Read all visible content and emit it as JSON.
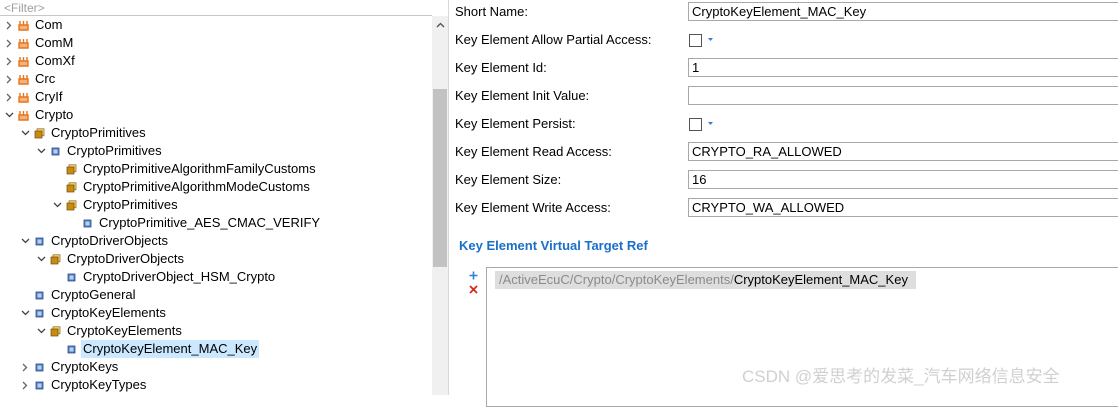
{
  "tree": {
    "filter_placeholder": "<Filter>",
    "items": [
      {
        "label": "Com",
        "expander": "collapsed",
        "icon": "module-icon",
        "indent": 0
      },
      {
        "label": "ComM",
        "expander": "collapsed",
        "icon": "module-icon",
        "indent": 0
      },
      {
        "label": "ComXf",
        "expander": "collapsed",
        "icon": "module-icon",
        "indent": 0
      },
      {
        "label": "Crc",
        "expander": "collapsed",
        "icon": "module-icon",
        "indent": 0
      },
      {
        "label": "CryIf",
        "expander": "collapsed",
        "icon": "module-icon",
        "indent": 0
      },
      {
        "label": "Crypto",
        "expander": "expanded",
        "icon": "module-icon",
        "indent": 0
      },
      {
        "label": "CryptoPrimitives",
        "expander": "expanded",
        "icon": "container-list-icon",
        "indent": 1
      },
      {
        "label": "CryptoPrimitives",
        "expander": "expanded",
        "icon": "container-icon",
        "indent": 2
      },
      {
        "label": "CryptoPrimitiveAlgorithmFamilyCustoms",
        "expander": "none",
        "icon": "container-list-icon",
        "indent": 3
      },
      {
        "label": "CryptoPrimitiveAlgorithmModeCustoms",
        "expander": "none",
        "icon": "container-list-icon",
        "indent": 3
      },
      {
        "label": "CryptoPrimitives",
        "expander": "expanded",
        "icon": "container-list-icon",
        "indent": 3
      },
      {
        "label": "CryptoPrimitive_AES_CMAC_VERIFY",
        "expander": "none",
        "icon": "container-icon",
        "indent": 4
      },
      {
        "label": "CryptoDriverObjects",
        "expander": "expanded",
        "icon": "container-icon",
        "indent": 1
      },
      {
        "label": "CryptoDriverObjects",
        "expander": "expanded",
        "icon": "container-list-icon",
        "indent": 2
      },
      {
        "label": "CryptoDriverObject_HSM_Crypto",
        "expander": "none",
        "icon": "container-icon",
        "indent": 3
      },
      {
        "label": "CryptoGeneral",
        "expander": "none",
        "icon": "container-icon",
        "indent": 1
      },
      {
        "label": "CryptoKeyElements",
        "expander": "expanded",
        "icon": "container-icon",
        "indent": 1
      },
      {
        "label": "CryptoKeyElements",
        "expander": "expanded",
        "icon": "container-list-icon",
        "indent": 2
      },
      {
        "label": "CryptoKeyElement_MAC_Key",
        "expander": "none",
        "icon": "container-icon",
        "indent": 3,
        "selected": true
      },
      {
        "label": "CryptoKeys",
        "expander": "collapsed",
        "icon": "container-icon",
        "indent": 1
      },
      {
        "label": "CryptoKeyTypes",
        "expander": "collapsed",
        "icon": "container-icon",
        "indent": 1
      }
    ]
  },
  "properties": {
    "short_name": {
      "label": "Short Name:",
      "value": "CryptoKeyElement_MAC_Key"
    },
    "allow_partial_access": {
      "label": "Key Element Allow Partial Access:",
      "checked": false
    },
    "element_id": {
      "label": "Key Element Id:",
      "value": "1"
    },
    "init_value": {
      "label": "Key Element Init Value:",
      "value": ""
    },
    "persist": {
      "label": "Key Element Persist:",
      "checked": false
    },
    "read_access": {
      "label": "Key Element Read Access:",
      "value": "CRYPTO_RA_ALLOWED"
    },
    "size": {
      "label": "Key Element Size:",
      "value": "16"
    },
    "write_access": {
      "label": "Key Element Write Access:",
      "value": "CRYPTO_WA_ALLOWED"
    }
  },
  "virtual_target_ref": {
    "title": "Key Element Virtual Target Ref",
    "path_prefix": "/ActiveEcuC/Crypto/CryptoKeyElements/",
    "path_leaf": "CryptoKeyElement_MAC_Key"
  },
  "watermark": "CSDN @爱思考的发菜_汽车网络信息安全",
  "colors": {
    "selection": "#cce8ff",
    "section_title": "#1a6fc9",
    "module_icon": "#e8751a",
    "container_icon": "#4f7fc6",
    "container_list_icon": "#c98a12"
  }
}
